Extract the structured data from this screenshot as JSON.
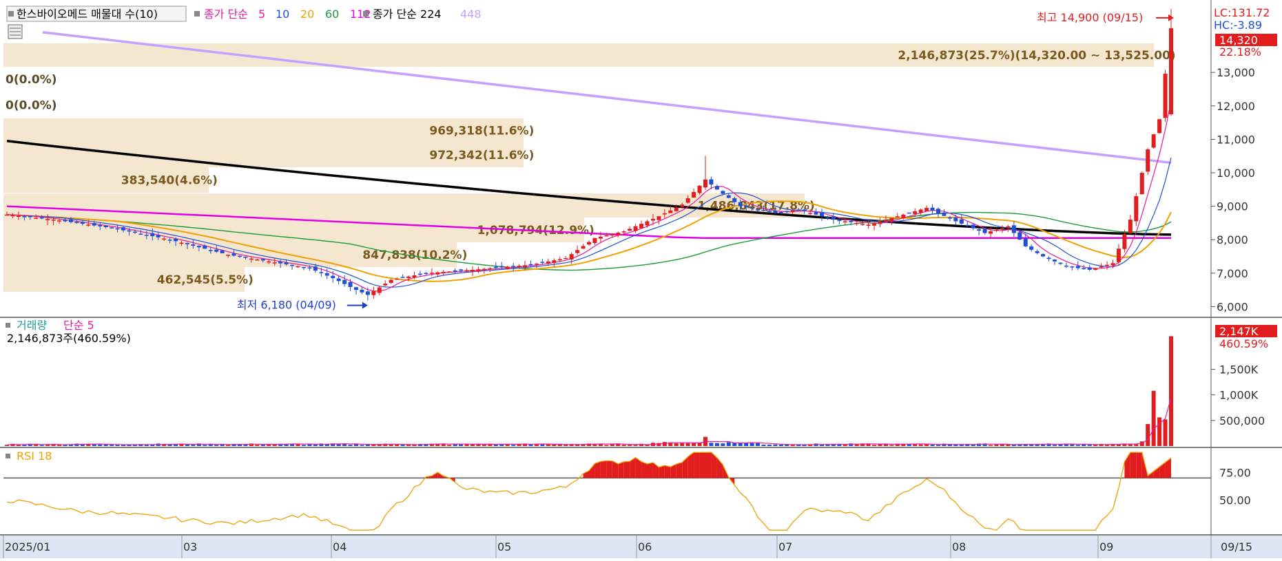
{
  "header": {
    "stock_name": "한스바이오메드 매물대 수(10)",
    "ma_label": "종가 단순",
    "ma_periods": [
      "5",
      "10",
      "20",
      "60",
      "112"
    ],
    "ma_colors": [
      "#e8189c",
      "#1f4fd6",
      "#f0a000",
      "#1a9a3a",
      "#e400e4"
    ],
    "ma2_label": "종가 단순 224",
    "ma2_extra": "448",
    "ma2_colors": [
      "#000000",
      "#c7a0ff"
    ]
  },
  "price_panel": {
    "lc_label": "LC:131.72",
    "hc_label": "HC:-3.89",
    "current_price": "14,320",
    "change_pct": "22.18%",
    "y_ticks": [
      "13,000",
      "12,000",
      "11,000",
      "10,000",
      "9,000",
      "8,000",
      "7,000",
      "6,000"
    ],
    "high_annotation": "최고 14,900 (09/15)",
    "low_annotation": "최저 6,180 (04/09)",
    "volume_profile": [
      {
        "label": "2,146,873(25.7%)(14,320.00 ~ 13,525.00)",
        "volume": 2146873,
        "pct": 25.7,
        "top": 14320,
        "bottom": 13525
      },
      {
        "label": "0(0.0%)",
        "volume": 0,
        "pct": 0.0
      },
      {
        "label": "0(0.0%)",
        "volume": 0,
        "pct": 0.0
      },
      {
        "label": "969,318(11.6%)",
        "volume": 969318,
        "pct": 11.6
      },
      {
        "label": "972,342(11.6%)",
        "volume": 972342,
        "pct": 11.6
      },
      {
        "label": "383,540(4.6%)",
        "volume": 383540,
        "pct": 4.6
      },
      {
        "label": "1,486,843(17.8%)",
        "volume": 1486843,
        "pct": 17.8
      },
      {
        "label": "1,078,794(12.9%)",
        "volume": 1078794,
        "pct": 12.9
      },
      {
        "label": "847,838(10.2%)",
        "volume": 847838,
        "pct": 10.2
      },
      {
        "label": "462,545(5.5%)",
        "volume": 462545,
        "pct": 5.5
      }
    ]
  },
  "volume_panel": {
    "title": "거래량",
    "ma_label": "단순 5",
    "summary": "2,146,873주(460.59%)",
    "current_volume": "2,147K",
    "change_pct": "460.59%",
    "y_ticks": [
      "1,500K",
      "1,000K",
      "500,000"
    ]
  },
  "rsi_panel": {
    "title": "RSI 18",
    "y_ticks": [
      "75.00",
      "50.00"
    ]
  },
  "x_axis": {
    "labels": [
      "2025/01",
      "03",
      "04",
      "05",
      "06",
      "07",
      "08",
      "09"
    ],
    "current_date": "09/15"
  },
  "chart_data": {
    "type": "candlestick",
    "ylim_price": [
      5700,
      15000
    ],
    "ylim_volume": [
      0,
      2300000
    ],
    "ylim_rsi": [
      20,
      95
    ],
    "rsi_threshold": 70,
    "high": {
      "date": "09/15",
      "value": 14900
    },
    "low": {
      "date": "04/09",
      "value": 6180
    },
    "last_close": 14320,
    "last_volume": 2146873,
    "ma224_start": 10950,
    "ma224_end": 8150,
    "ma448_start": 14200,
    "ma448_end": 10300,
    "ma112_start": 9000,
    "ma112_end": 8050
  }
}
